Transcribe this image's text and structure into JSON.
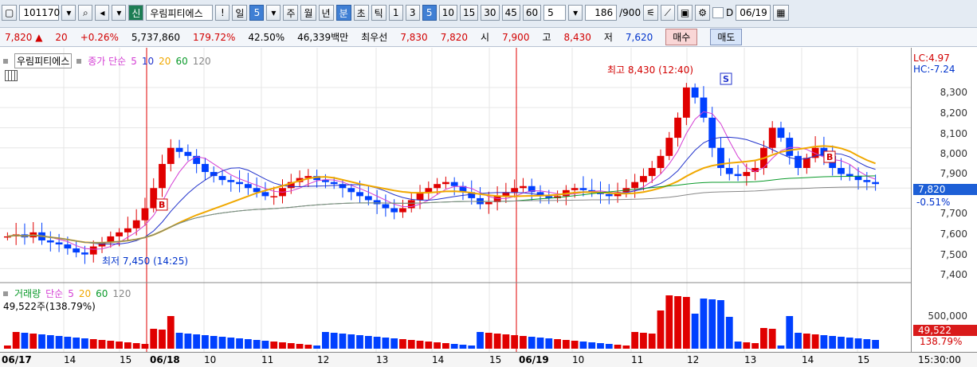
{
  "toolbar": {
    "code": "101170",
    "name": "우림피티에스",
    "sin": "신",
    "excl": "!",
    "period_day": "일",
    "day_count": "5",
    "tabs": [
      "주",
      "월",
      "년",
      "분",
      "초",
      "틱"
    ],
    "minute_options": [
      "1",
      "3",
      "5",
      "10",
      "15",
      "30",
      "45",
      "60"
    ],
    "minute_selected": "5",
    "count_select": "5",
    "bars": "186",
    "bars_total": "/900",
    "d_label": "D",
    "date": "06/19"
  },
  "quote": {
    "price": "7,820",
    "arrow": "▲",
    "change": "20",
    "change_pct": "+0.26%",
    "volume": "5,737,860",
    "vol_ratio": "179.72%",
    "turnover": "42.50%",
    "amount": "46,339백만",
    "best_label": "최우선",
    "ask": "7,830",
    "bid": "7,820",
    "open_label": "시",
    "open": "7,900",
    "high_label": "고",
    "high": "8,430",
    "low_label": "저",
    "low": "7,620",
    "buy_label": "매수",
    "sell_label": "매도"
  },
  "price_panel": {
    "legend_name": "우림피티에스",
    "legend_ma": "종가 단순",
    "ma_periods": [
      "5",
      "10",
      "20",
      "60",
      "120"
    ],
    "lc": "LC:4.97",
    "hc": "HC:-7.24",
    "high_note": "최고 8,430 (12:40)",
    "low_note": "최저 7,450 (14:25)",
    "current_price": "7,820",
    "current_pct": "-0.51%",
    "y_ticks": [
      "8,300",
      "8,200",
      "8,100",
      "8,000",
      "7,900",
      "7,700",
      "7,600",
      "7,500",
      "7,400"
    ]
  },
  "volume_panel": {
    "legend_name": "거래량",
    "legend_ma": "단순",
    "ma_periods": [
      "5",
      "20",
      "60",
      "120"
    ],
    "info": "49,522주(138.79%)",
    "tick": "500,000",
    "current": "49,522",
    "current_pct": "138.79%"
  },
  "x_labels": [
    "06/17",
    "14",
    "15",
    "06/18",
    "10",
    "11",
    "12",
    "13",
    "14",
    "15",
    "06/19",
    "10",
    "11",
    "12",
    "13",
    "14",
    "15",
    "15:30:00"
  ],
  "colors": {
    "up": "#e00000",
    "down": "#0040ff",
    "ma5": "#d43fd4",
    "ma10": "#2233cc",
    "ma20": "#f0a800",
    "ma60": "#0a9a2a",
    "ma120": "#888888"
  },
  "chart_data": {
    "type": "candlestick",
    "price_series": [
      7560,
      7570,
      7555,
      7580,
      7540,
      7530,
      7520,
      7500,
      7480,
      7470,
      7510,
      7530,
      7560,
      7580,
      7600,
      7640,
      7700,
      7800,
      7920,
      8000,
      7980,
      7960,
      7920,
      7880,
      7860,
      7840,
      7830,
      7820,
      7800,
      7780,
      7760,
      7760,
      7800,
      7830,
      7850,
      7860,
      7840,
      7830,
      7820,
      7800,
      7780,
      7760,
      7740,
      7720,
      7700,
      7680,
      7700,
      7740,
      7780,
      7800,
      7820,
      7830,
      7810,
      7780,
      7750,
      7720,
      7730,
      7760,
      7780,
      7800,
      7810,
      7780,
      7760,
      7750,
      7760,
      7790,
      7800,
      7790,
      7780,
      7770,
      7760,
      7780,
      7800,
      7830,
      7860,
      7900,
      7960,
      8050,
      8150,
      8300,
      8250,
      8150,
      8000,
      7900,
      7870,
      7860,
      7880,
      7900,
      8000,
      8100,
      8050,
      7960,
      7900,
      7950,
      8000,
      7960,
      7900,
      7870,
      7860,
      7840,
      7830,
      7820
    ],
    "y_range": [
      7350,
      8450
    ]
  }
}
